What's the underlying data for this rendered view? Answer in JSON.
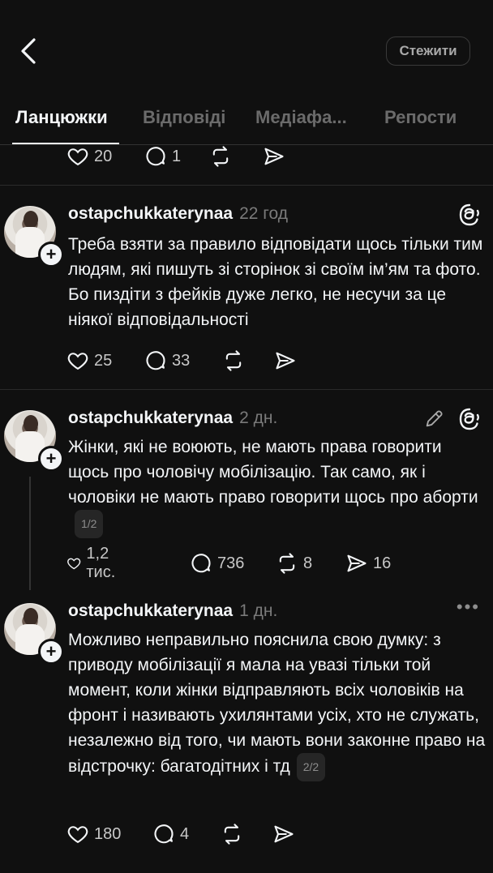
{
  "header": {
    "follow_label": "Стежити"
  },
  "tabs": [
    {
      "label": "Ланцюжки"
    },
    {
      "label": "Відповіді"
    },
    {
      "label": "Медіафа..."
    },
    {
      "label": "Репости"
    }
  ],
  "top_partial_actions": {
    "likes": "20",
    "comments": "1"
  },
  "posts": [
    {
      "username": "ostapchukkaterynaa",
      "time": "22 год",
      "text": "Треба взяти за правило відповідати щось тільки тим людям, які пишуть зі сторінок зі своїм ім’ям та фото. Бо пиздіти з фейків дуже легко, не несучи за це ніякої відповідальності",
      "likes": "25",
      "comments": "33",
      "reposts": "",
      "shares": ""
    },
    {
      "username": "ostapchukkaterynaa",
      "time": "2 дн.",
      "text": "Жінки, які не воюють, не мають права говорити щось про чоловічу мобілізацію. Так само, як і чоловіки не мають право говорити щось про аборти",
      "pager": "1/2",
      "likes": "1,2 тис.",
      "comments": "736",
      "reposts": "8",
      "shares": "16"
    },
    {
      "username": "ostapchukkaterynaa",
      "time": "1 дн.",
      "text": "Можливо неправильно пояснила свою думку: з приводу мобілізації я мала на увазі тільки той момент, коли жінки відправляють всіх чоловіків на фронт і називають ухилянтами усіх, хто не служать, незалежно від того, чи мають вони законне право на відстрочку: багатодітних і тд",
      "pager": "2/2",
      "likes": "180",
      "comments": "4",
      "reposts": "",
      "shares": ""
    }
  ],
  "colors": {
    "background": "#101010",
    "text": "#f3f5f7",
    "muted": "#7a7a7a"
  }
}
